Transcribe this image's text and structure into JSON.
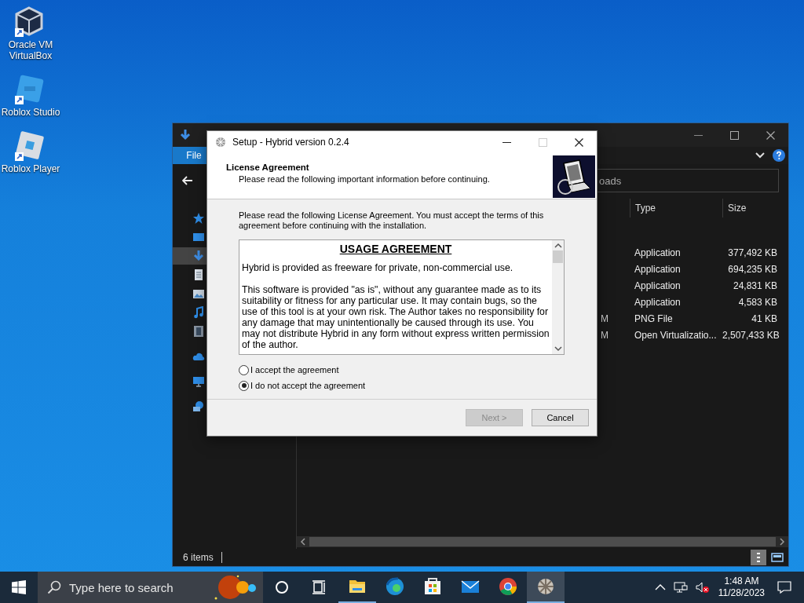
{
  "desktop_icons": [
    {
      "label": "Oracle VM VirtualBox",
      "kind": "cube"
    },
    {
      "label": "Roblox Studio",
      "kind": "studio"
    },
    {
      "label": "Roblox Player",
      "kind": "player"
    }
  ],
  "explorer": {
    "menu_tab": "File",
    "search_placeholder": "oads",
    "nav_items": [
      {
        "kind": "star",
        "selected": false
      },
      {
        "kind": "desktop",
        "selected": false
      },
      {
        "kind": "download",
        "selected": true
      },
      {
        "kind": "document",
        "selected": false
      },
      {
        "kind": "picture",
        "selected": false
      },
      {
        "kind": "music",
        "selected": false
      },
      {
        "kind": "video",
        "selected": false
      },
      {
        "kind": "cloud",
        "selected": false
      },
      {
        "kind": "pc",
        "selected": false
      },
      {
        "kind": "network",
        "selected": false
      }
    ],
    "columns": [
      "Type",
      "Size"
    ],
    "rows": [
      {
        "type": "Application",
        "size": "377,492 KB"
      },
      {
        "type": "Application",
        "size": "694,235 KB"
      },
      {
        "type": "Application",
        "size": "24,831 KB"
      },
      {
        "type": "Application",
        "size": "4,583 KB"
      },
      {
        "date": "M",
        "type": "PNG File",
        "size": "41 KB"
      },
      {
        "date": "M",
        "type": "Open Virtualizatio...",
        "size": "2,507,433 KB"
      }
    ],
    "status": "6 items"
  },
  "dialog": {
    "title": "Setup - Hybrid version 0.2.4",
    "heading": "License Agreement",
    "subheading": "Please read the following important information before continuing.",
    "instruction": "Please read the following License Agreement. You must accept the terms of this agreement before continuing with the installation.",
    "license_title": "USAGE AGREEMENT",
    "license_paragraphs": [
      "Hybrid is provided as freeware for private, non-commercial use.",
      "This software is provided \"as is\", without any guarantee made as to its suitability or fitness for any particular use. It may contain bugs, so the use of this tool is at your own risk. The Author takes no responsibility for any damage that may unintentionally be caused through its use. You may not distribute Hybrid in any form without express written permission of the author."
    ],
    "options": [
      {
        "label": "I accept the agreement",
        "selected": false
      },
      {
        "label": "I do not accept the agreement",
        "selected": true
      }
    ],
    "buttons": [
      {
        "label": "Next >",
        "disabled": true
      },
      {
        "label": "Cancel",
        "disabled": false
      }
    ]
  },
  "taskbar": {
    "search_placeholder": "Type here to search",
    "apps": [
      {
        "kind": "explorer",
        "active": false
      },
      {
        "kind": "edge",
        "active": false
      },
      {
        "kind": "store",
        "active": false
      },
      {
        "kind": "mail",
        "active": false
      },
      {
        "kind": "chrome",
        "active": false
      },
      {
        "kind": "setup",
        "active": true
      }
    ],
    "time": "1:48 AM",
    "date": "11/28/2023"
  }
}
